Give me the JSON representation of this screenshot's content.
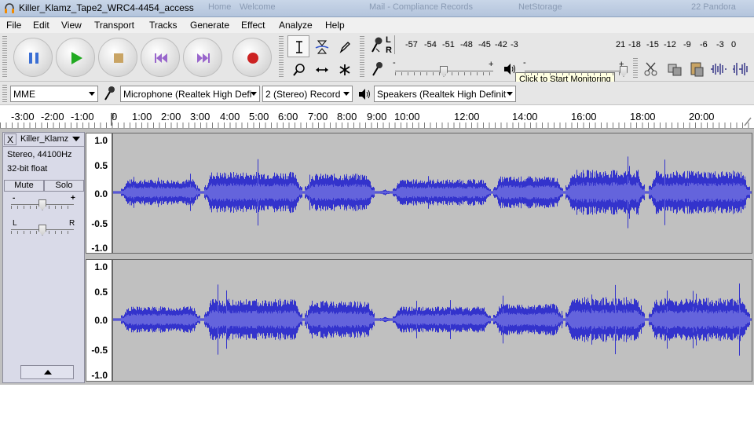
{
  "window": {
    "title": "Killer_Klamz_Tape2_WRC4-4454_access",
    "background_tabs": [
      "Home",
      "Welcome",
      "Mail - Compliance Records",
      "NetStorage",
      "22 Pandora"
    ]
  },
  "menu": [
    "File",
    "Edit",
    "View",
    "Transport",
    "Tracks",
    "Generate",
    "Effect",
    "Analyze",
    "Help"
  ],
  "transport": {
    "buttons": [
      "pause-icon",
      "play-icon",
      "stop-icon",
      "skip-to-start-icon",
      "skip-to-end-icon",
      "record-icon"
    ]
  },
  "meter": {
    "left_label": "L",
    "right_label": "R",
    "scale": [
      "-57",
      "-54",
      "-51",
      "-48",
      "-45",
      "-42",
      "-3",
      "21",
      "-18",
      "-15",
      "-12",
      "-9",
      "-6",
      "-3",
      "0"
    ],
    "tooltip": "Click to Start Monitoring",
    "minus": "-",
    "plus": "+"
  },
  "devices": {
    "host": "MME",
    "input_device": "Microphone (Realtek High Defi",
    "channels": "2 (Stereo) Record",
    "output_device": "Speakers (Realtek High Definit"
  },
  "timeline": {
    "labels": [
      "-3:00",
      "-2:00",
      "-1:00",
      "0",
      "1:00",
      "2:00",
      "3:00",
      "4:00",
      "5:00",
      "6:00",
      "7:00",
      "8:00",
      "9:00",
      "10:00",
      "12:00",
      "14:00",
      "16:00",
      "18:00",
      "20:00"
    ]
  },
  "track": {
    "close_label": "X",
    "name": "Killer_Klamz",
    "format": "Stereo, 44100Hz",
    "bit_depth": "32-bit float",
    "mute_label": "Mute",
    "solo_label": "Solo",
    "gain_minus": "-",
    "gain_plus": "+",
    "pan_left": "L",
    "pan_right": "R",
    "gain_level": 0.5,
    "pan_level": 0.5,
    "amplitude_scale": [
      "1.0",
      "0.5",
      "0.0",
      "-0.5",
      "-1.0"
    ]
  },
  "colors": {
    "waveform": "#3333cc",
    "waveform_rms": "#6464dc",
    "track_bg": "#c0c0c0",
    "record": "#cc2222",
    "play": "#22aa22"
  }
}
